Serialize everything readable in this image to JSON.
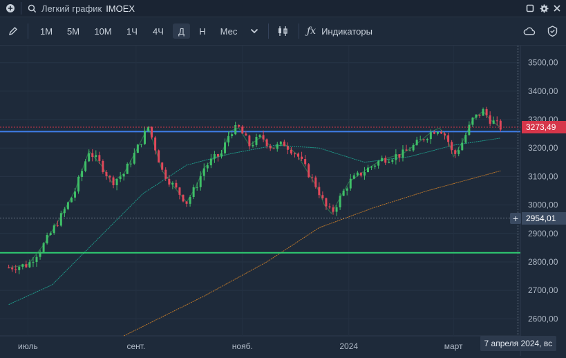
{
  "header": {
    "search_placeholder": "Легкий график",
    "ticker": "IMOEX"
  },
  "toolbar": {
    "intervals": [
      "1М",
      "5М",
      "10М",
      "1Ч",
      "4Ч",
      "Д",
      "Н",
      "Мес"
    ],
    "active_interval": "Д",
    "indicators_label": "Индикаторы"
  },
  "chart_data": {
    "type": "line",
    "y_ticks": [
      "3500,00",
      "3400,00",
      "3300,00",
      "3200,00",
      "3100,00",
      "3000,00",
      "2900,00",
      "2800,00",
      "2700,00",
      "2600,00"
    ],
    "x_ticks": [
      "июль",
      "сент.",
      "нояб.",
      "2024",
      "март"
    ],
    "ylim": [
      2540,
      3560
    ],
    "current_price": "3273,49",
    "cursor_price": "2954,01",
    "cursor_date": "7 апреля 2024, вс",
    "horizontal_levels": [
      {
        "value": 3258,
        "color": "#3f7ee8"
      },
      {
        "value": 2832,
        "color": "#2ecc71"
      }
    ],
    "price_series": {
      "x": [
        "2023-06-20",
        "2023-07-01",
        "2023-07-10",
        "2023-07-20",
        "2023-07-28",
        "2023-08-05",
        "2023-08-12",
        "2023-08-18",
        "2023-08-25",
        "2023-09-01",
        "2023-09-08",
        "2023-09-12",
        "2023-09-16",
        "2023-09-22",
        "2023-09-30",
        "2023-10-05",
        "2023-10-10",
        "2023-10-15",
        "2023-10-20",
        "2023-10-25",
        "2023-10-30",
        "2023-11-05",
        "2023-11-12",
        "2023-11-18",
        "2023-11-25",
        "2023-12-02",
        "2023-12-08",
        "2023-12-14",
        "2023-12-18",
        "2023-12-22",
        "2024-01-01",
        "2024-01-10",
        "2024-01-20",
        "2024-02-01",
        "2024-02-10",
        "2024-02-18",
        "2024-02-22",
        "2024-02-26",
        "2024-03-01",
        "2024-03-06",
        "2024-03-12",
        "2024-03-18",
        "2024-03-22",
        "2024-03-28"
      ],
      "y": [
        2780,
        2790,
        2860,
        2960,
        3050,
        3190,
        3140,
        3080,
        3110,
        3190,
        3275,
        3200,
        3120,
        3070,
        3010,
        3060,
        3130,
        3160,
        3180,
        3260,
        3270,
        3210,
        3240,
        3200,
        3215,
        3180,
        3120,
        3060,
        3000,
        2970,
        3080,
        3120,
        3160,
        3180,
        3220,
        3260,
        3270,
        3240,
        3170,
        3220,
        3300,
        3330,
        3300,
        3273
      ]
    },
    "ma_fast": {
      "x": [
        "2023-06-20",
        "2023-07-15",
        "2023-08-10",
        "2023-09-05",
        "2023-09-30",
        "2023-10-25",
        "2023-11-20",
        "2023-12-15",
        "2024-01-10",
        "2024-02-05",
        "2024-03-01",
        "2024-03-28"
      ],
      "y": [
        2650,
        2720,
        2880,
        3040,
        3140,
        3180,
        3210,
        3200,
        3150,
        3170,
        3210,
        3235
      ]
    },
    "ma_slow": {
      "x": [
        "2023-08-25",
        "2023-10-10",
        "2023-11-15",
        "2023-12-15",
        "2024-01-15",
        "2024-02-15",
        "2024-03-28"
      ],
      "y": [
        2540,
        2680,
        2800,
        2920,
        2990,
        3050,
        3120
      ]
    }
  }
}
